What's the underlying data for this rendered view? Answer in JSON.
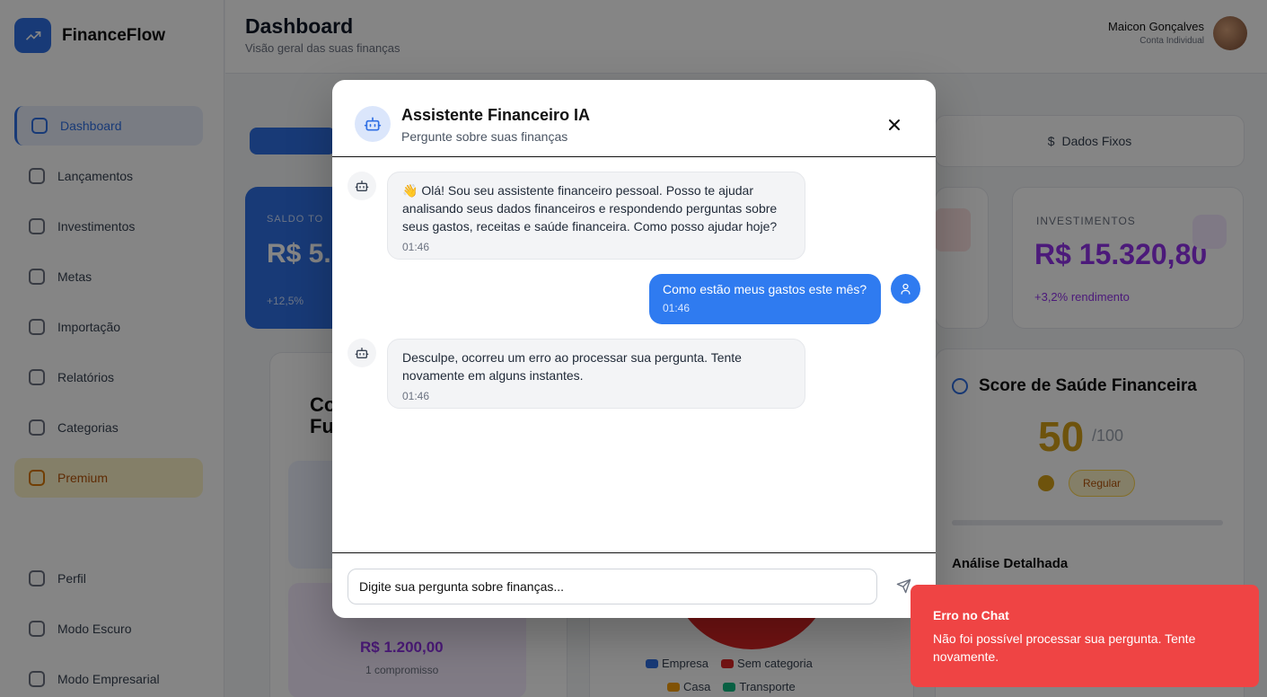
{
  "app": {
    "name": "FinanceFlow",
    "page_title": "Dashboard",
    "page_subtitle": "Visão geral das suas finanças",
    "user_name": "Maicon Gonçalves",
    "user_role": "Conta Individual"
  },
  "sidebar": {
    "items": [
      {
        "label": "Dashboard"
      },
      {
        "label": "Lançamentos"
      },
      {
        "label": "Investimentos"
      },
      {
        "label": "Metas"
      },
      {
        "label": "Importação"
      },
      {
        "label": "Relatórios"
      },
      {
        "label": "Categorias"
      },
      {
        "label": "Premium"
      }
    ],
    "bottom_items": [
      {
        "label": "Perfil"
      },
      {
        "label": "Modo Escuro"
      },
      {
        "label": "Modo Empresarial"
      }
    ]
  },
  "background": {
    "tab_right_label": "Dados Fixos",
    "balance_label": "SALDO TO",
    "balance_value": "R$ 5.",
    "balance_trend": "+12,5%",
    "investments_label": "INVESTIMENTOS",
    "investments_value": "R$ 15.320,80",
    "investments_trend": "+3,2% rendimento",
    "left_card_title_1": "Co",
    "left_card_title_2": "Fu",
    "left_card_amount": "R$ 1.200,00",
    "left_card_note": "1 compromisso",
    "score_title": "Score de Saúde Financeira",
    "score_value": "50",
    "score_max": "/100",
    "score_badge": "Regular",
    "score_subtitle": "Análise Detalhada",
    "legend_1": [
      "Empresa",
      "Sem categoria"
    ],
    "legend_2": [
      "Casa",
      "Transporte"
    ]
  },
  "chat": {
    "title": "Assistente Financeiro IA",
    "subtitle": "Pergunte sobre suas finanças",
    "messages": [
      {
        "role": "bot",
        "text": "👋 Olá! Sou seu assistente financeiro pessoal. Posso te ajudar analisando seus dados financeiros e respondendo perguntas sobre seus gastos, receitas e saúde financeira. Como posso ajudar hoje?",
        "time": "01:46"
      },
      {
        "role": "user",
        "text": "Como estão meus gastos este mês?",
        "time": "01:46"
      },
      {
        "role": "bot",
        "text": "Desculpe, ocorreu um erro ao processar sua pergunta. Tente novamente em alguns instantes.",
        "time": "01:46"
      }
    ],
    "input_value": "Digite sua pergunta sobre finanças..."
  },
  "toast": {
    "title": "Erro no Chat",
    "message": "Não foi possível processar sua pergunta. Tente novamente."
  },
  "colors": {
    "accent": "#2f7bf0",
    "error": "#ef4444",
    "investments": "#9333ea",
    "score": "#d4a017"
  }
}
